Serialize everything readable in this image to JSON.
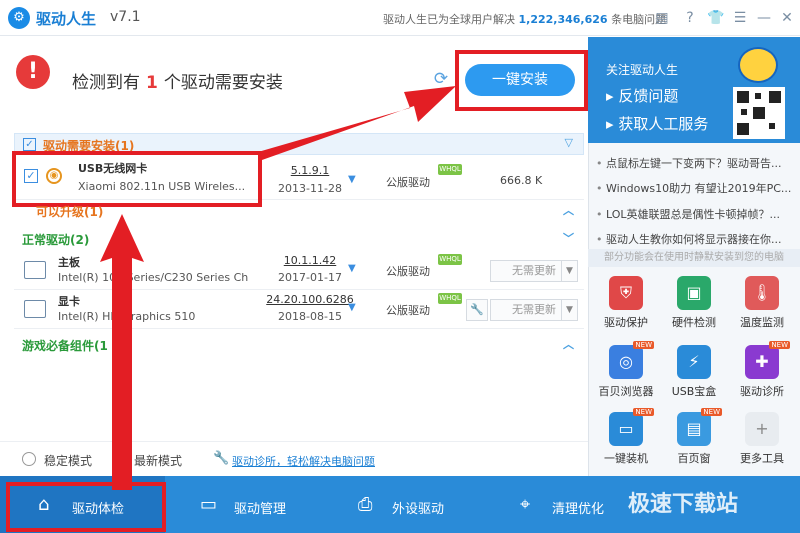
{
  "titlebar": {
    "app_name": "驱动人生",
    "version": "v7.1",
    "tagline_prefix": "驱动人生已为全球用户解决",
    "user_count": "1,222,346,626",
    "tagline_suffix": "条电脑问题"
  },
  "header": {
    "detect_prefix": "检测到有",
    "detect_count": "1",
    "detect_suffix": "个驱动需要安装",
    "install_button": "一键安装"
  },
  "sections": {
    "need_install": "驱动需要安装(1)",
    "upgradable": "可以升级(1)",
    "normal": "正常驱动(2)",
    "game": "游戏必备组件(1"
  },
  "drivers": [
    {
      "name": "USB无线网卡",
      "desc": "Xiaomi 802.11n USB Wireles...",
      "version": "5.1.9.1",
      "date": "2013-11-28",
      "type": "公版驱动",
      "size": "666.8 K"
    },
    {
      "name": "主板",
      "desc": "Intel(R) 100 Series/C230 Series Ch...",
      "version": "10.1.1.42",
      "date": "2017-01-17",
      "type": "公版驱动",
      "action": "无需更新"
    },
    {
      "name": "显卡",
      "desc": "Intel(R) HD Graphics 510",
      "version": "24.20.100.6286",
      "date": "2018-08-15",
      "type": "公版驱动",
      "action": "无需更新"
    }
  ],
  "whql": "WHQL",
  "modes": {
    "stable": "稳定模式",
    "latest": "最新模式",
    "diag_link": "驱动诊所，轻松解决电脑问题"
  },
  "right_panel": {
    "follow": "关注驱动人生",
    "feedback": "反馈问题",
    "service": "获取人工服务",
    "news": [
      "点鼠标左键一下变两下？驱动哥告...",
      "Windows10助力 有望让2019年PC...",
      "LOL英雄联盟总是偶性卡顿掉帧？...",
      "驱动人生教你如何将显示器接在你..."
    ],
    "feature_strip": "部分功能会在使用时静默安装到您的电脑",
    "tiles": [
      {
        "label": "驱动保护",
        "color": "#e04848",
        "glyph": "⛨",
        "new": false
      },
      {
        "label": "硬件检测",
        "color": "#2aa86a",
        "glyph": "▣",
        "new": false
      },
      {
        "label": "温度监测",
        "color": "#e05a5a",
        "glyph": "🌡",
        "new": false
      },
      {
        "label": "百贝浏览器",
        "color": "#3a7fe0",
        "glyph": "◎",
        "new": true
      },
      {
        "label": "USB宝盒",
        "color": "#2a8bd8",
        "glyph": "⚡",
        "new": false
      },
      {
        "label": "驱动诊所",
        "color": "#8a3ad0",
        "glyph": "✚",
        "new": true
      },
      {
        "label": "一键装机",
        "color": "#2a8bd8",
        "glyph": "▭",
        "new": true
      },
      {
        "label": "百页窗",
        "color": "#3a9ae0",
        "glyph": "▤",
        "new": true
      },
      {
        "label": "更多工具",
        "color": "#e8ecf0",
        "glyph": "+",
        "new": false
      }
    ]
  },
  "nav": [
    {
      "label": "驱动体检",
      "glyph": "⌂"
    },
    {
      "label": "驱动管理",
      "glyph": "▭"
    },
    {
      "label": "外设驱动",
      "glyph": "⎙"
    },
    {
      "label": "清理优化",
      "glyph": "⌖"
    }
  ],
  "watermark": "极速下载站"
}
